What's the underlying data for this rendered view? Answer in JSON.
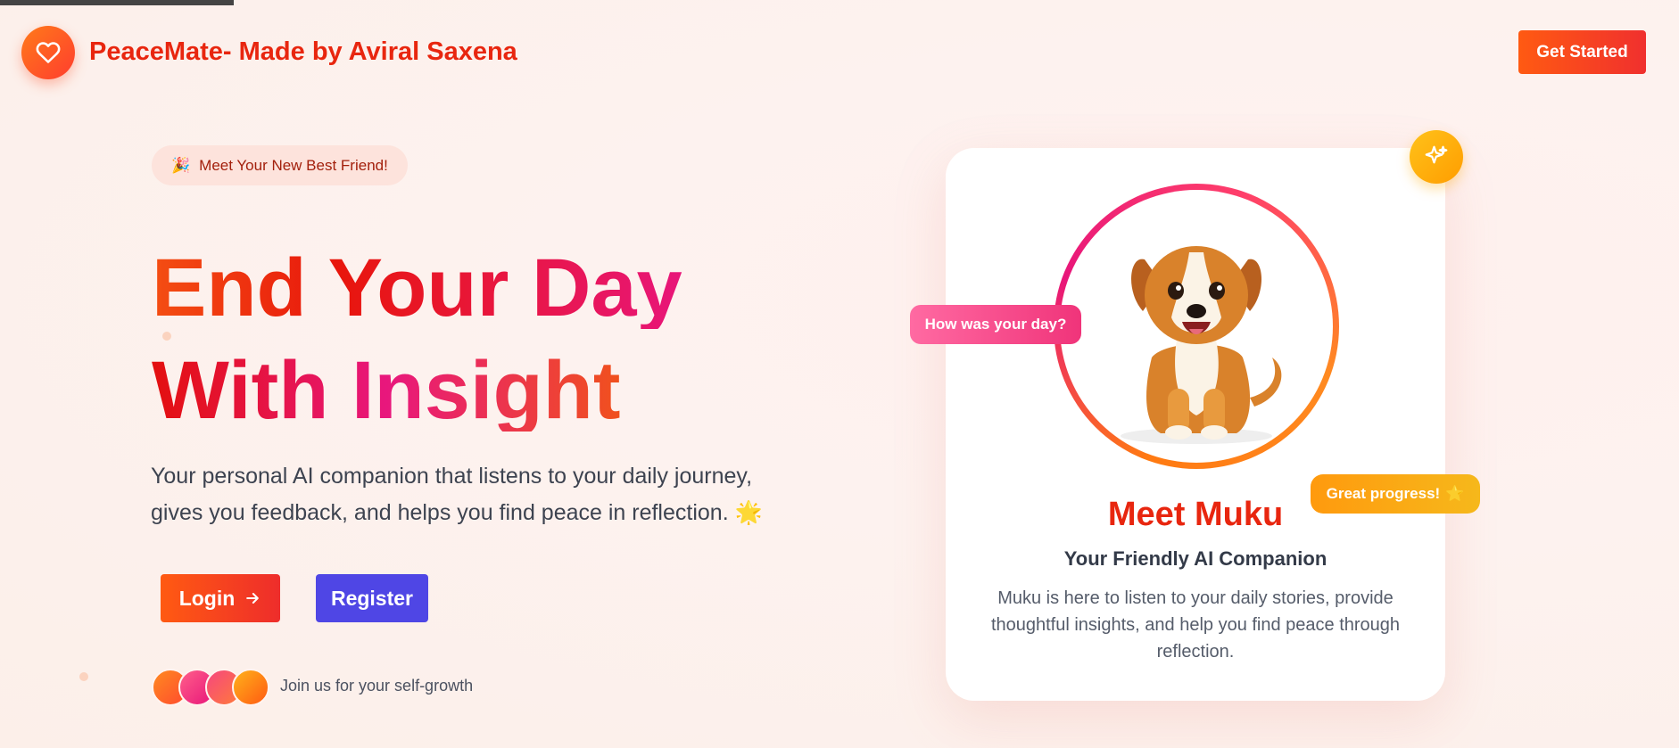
{
  "header": {
    "brand": "PeaceMate- Made by Aviral Saxena",
    "cta_label": "Get Started",
    "logo_icon": "heart-icon"
  },
  "hero": {
    "badge_emoji": "🎉",
    "badge_label": "Meet Your New Best Friend!",
    "title_line_1": "End Your Day",
    "title_line_2": "With Insight",
    "subtitle": "Your personal AI companion that listens to your daily journey, gives you feedback, and helps you find peace in reflection. 🌟",
    "login_label": "Login",
    "register_label": "Register",
    "social_proof": "Join us for your self-growth"
  },
  "companion": {
    "speech_bubble": "How was your day?",
    "progress_bubble": "Great progress!",
    "progress_emoji": "⭐",
    "name": "Meet Muku",
    "tagline": "Your Friendly AI Companion",
    "description": "Muku is here to listen to your daily stories, provide thoughtful insights, and help you find peace through reflection."
  },
  "colors": {
    "primary": "#ff5a12",
    "brand_text": "#e8260f",
    "register": "#4f46e5",
    "accent_pink": "#e8167a",
    "accent_yellow": "#ffc21a"
  }
}
